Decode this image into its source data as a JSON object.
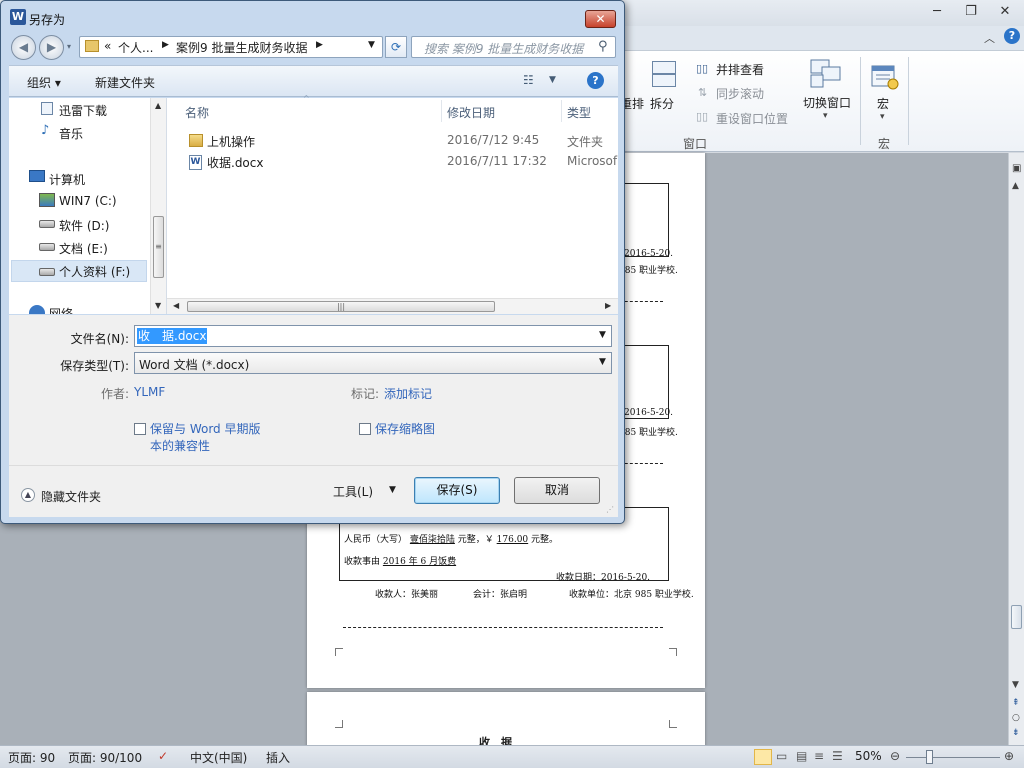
{
  "dialog": {
    "title": "另存为",
    "app_icon_letter": "W",
    "close_symbol": "✕",
    "back_symbol": "◀",
    "forward_symbol": "▶",
    "path": {
      "prefix": "«",
      "crumb1": "个人...",
      "crumb2": "案例9 批量生成财务收据"
    },
    "search_placeholder": "搜索 案例9 批量生成财务收据",
    "toolbar": {
      "organize": "组织 ▾",
      "new_folder": "新建文件夹"
    },
    "nav_items": [
      "迅雷下载",
      "音乐",
      "计算机",
      "WIN7 (C:)",
      "软件 (D:)",
      "文档 (E:)",
      "个人资料 (F:)",
      "网络"
    ],
    "columns": {
      "name": "名称",
      "date": "修改日期",
      "type": "类型"
    },
    "files": [
      {
        "name": "上机操作",
        "date": "2016/7/12 9:45",
        "type": "文件夹",
        "icon": "folder-icon"
      },
      {
        "name": "收据.docx",
        "date": "2016/7/11 17:32",
        "type": "Microsof",
        "icon": "word-doc-icon"
      }
    ],
    "filename_label": "文件名(N):",
    "filename_value": "收　据.docx",
    "savetype_label": "保存类型(T):",
    "savetype_value": "Word 文档 (*.docx)",
    "author_label": "作者:",
    "author_value": "YLMF",
    "tags_label": "标记:",
    "tags_value": "添加标记",
    "compat_line1": "保留与 Word 早期版",
    "compat_line2": "本的兼容性",
    "compat_checked": false,
    "thumbnail_label": "保存缩略图",
    "thumbnail_checked": false,
    "hide_folders": "隐藏文件夹",
    "tools_label": "工具(L)",
    "save_button": "保存(S)",
    "cancel_button": "取消"
  },
  "word": {
    "ribbon": {
      "side_by_side": "并排查看",
      "sync_scroll": "同步滚动",
      "reset_position": "重设窗口位置",
      "arrange_partial": "重排",
      "split": "拆分",
      "switch_window": "切换窗口",
      "macros": "宏",
      "group_window": "窗口",
      "group_macros": "宏"
    },
    "doc": {
      "date_1": "2016-5-20.",
      "stamp_text": "985 职业学校.",
      "amount_line_label": "人民币（大写）",
      "amount_words": "壹佰柒拾陆",
      "amount_yuan": "元整，￥",
      "amount_number": "176.00",
      "amount_tail": "元整。",
      "reason_label": "收款事由",
      "reason_value": "2016 年 6 月饭费",
      "receipt_date": "收款日期：2016-5-20.",
      "payee": "收款人：张美丽",
      "accountant": "会计：张启明",
      "payee_unit": "收款单位：北京 985 职业学校.",
      "next_title": "收　据"
    },
    "status": {
      "page": "页面: 90",
      "page_of": "页面: 90/100",
      "language": "中文(中国)",
      "mode": "插入",
      "zoom": "50%"
    }
  }
}
